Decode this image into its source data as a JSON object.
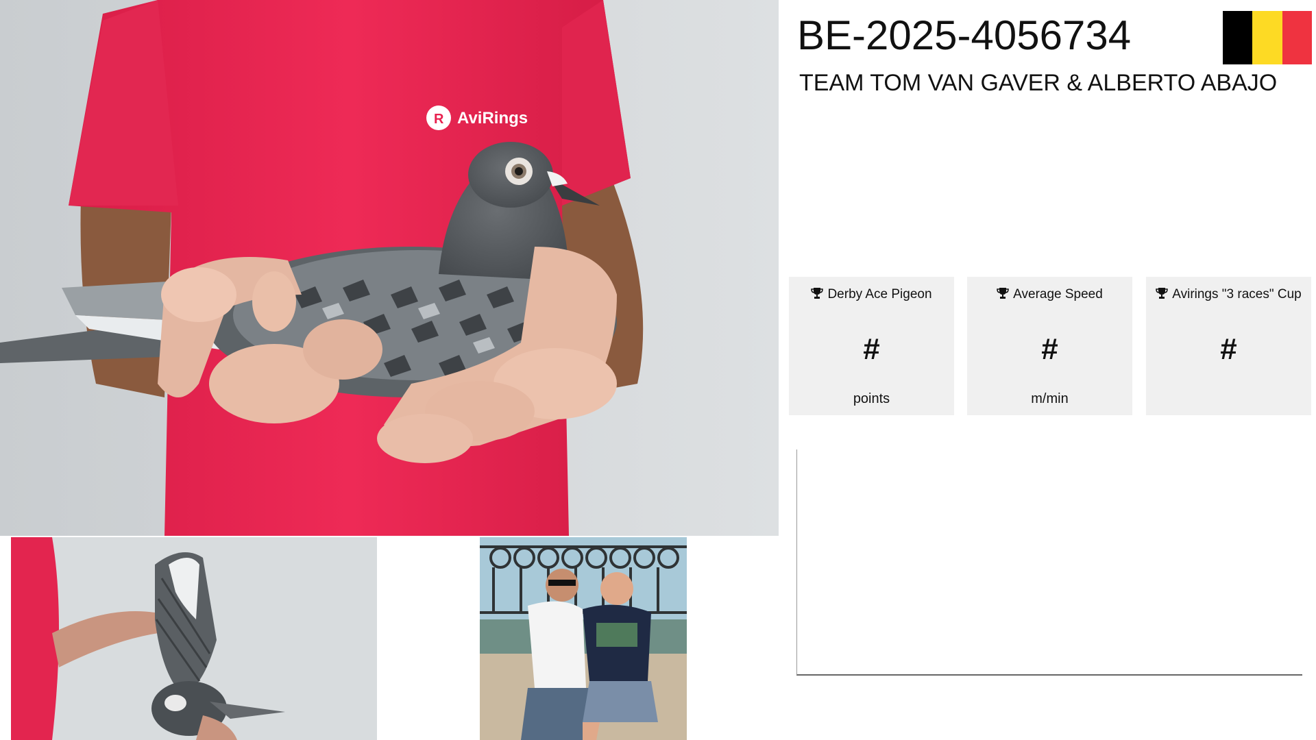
{
  "header": {
    "ring_number": "BE-2025-4056734",
    "owner": "TEAM TOM VAN GAVER & ALBERTO ABAJO",
    "flag_colors": [
      "#000000",
      "#FDDA24",
      "#EF3340"
    ]
  },
  "photos": {
    "shirt_logo_text": "AviRings"
  },
  "stats": [
    {
      "title": "Derby Ace Pigeon",
      "value": "#",
      "unit": "points",
      "icon": "trophy-icon"
    },
    {
      "title": "Average Speed",
      "value": "#",
      "unit": "m/min",
      "icon": "trophy-icon"
    },
    {
      "title": "Avirings \"3 races\" Cup",
      "value": "#",
      "unit": "",
      "icon": "trophy-icon"
    }
  ],
  "colors": {
    "shirt_red": "#e8214f",
    "card_bg": "#f0f0f0"
  }
}
